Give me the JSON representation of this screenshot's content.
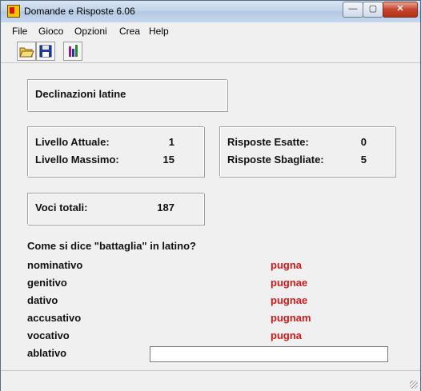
{
  "window": {
    "title": "Domande e Risposte 6.06"
  },
  "controls": {
    "minimize": "—",
    "maximize": "▢",
    "close": "✕"
  },
  "menu": {
    "items": [
      {
        "label": "File"
      },
      {
        "label": "Gioco"
      },
      {
        "label": "Opzioni"
      },
      {
        "label": "Crea"
      },
      {
        "label": "Help"
      }
    ]
  },
  "toolbar": {
    "buttons": [
      {
        "icon": "open-folder-icon"
      },
      {
        "icon": "save-disk-icon"
      },
      {
        "icon": "stats-icon"
      }
    ]
  },
  "quiz": {
    "name": "Declinazioni latine",
    "livello_attuale_label": "Livello Attuale:",
    "livello_attuale": "1",
    "livello_massimo_label": "Livello Massimo:",
    "livello_massimo": "15",
    "risposte_esatte_label": "Risposte Esatte:",
    "risposte_esatte": "0",
    "risposte_sbagliate_label": "Risposte Sbagliate:",
    "risposte_sbagliate": "5",
    "voci_totali_label": "Voci totali:",
    "voci_totali": "187",
    "question": "Come si dice \"battaglia\" in latino?",
    "cases": [
      {
        "case": "nominativo",
        "answer": "pugna"
      },
      {
        "case": "genitivo",
        "answer": "pugnae"
      },
      {
        "case": "dativo",
        "answer": "pugnae"
      },
      {
        "case": "accusativo",
        "answer": "pugnam"
      },
      {
        "case": "vocativo",
        "answer": "pugna"
      }
    ],
    "input_case": "ablativo",
    "input_value": ""
  },
  "colors": {
    "answer": "#d21a1a"
  }
}
